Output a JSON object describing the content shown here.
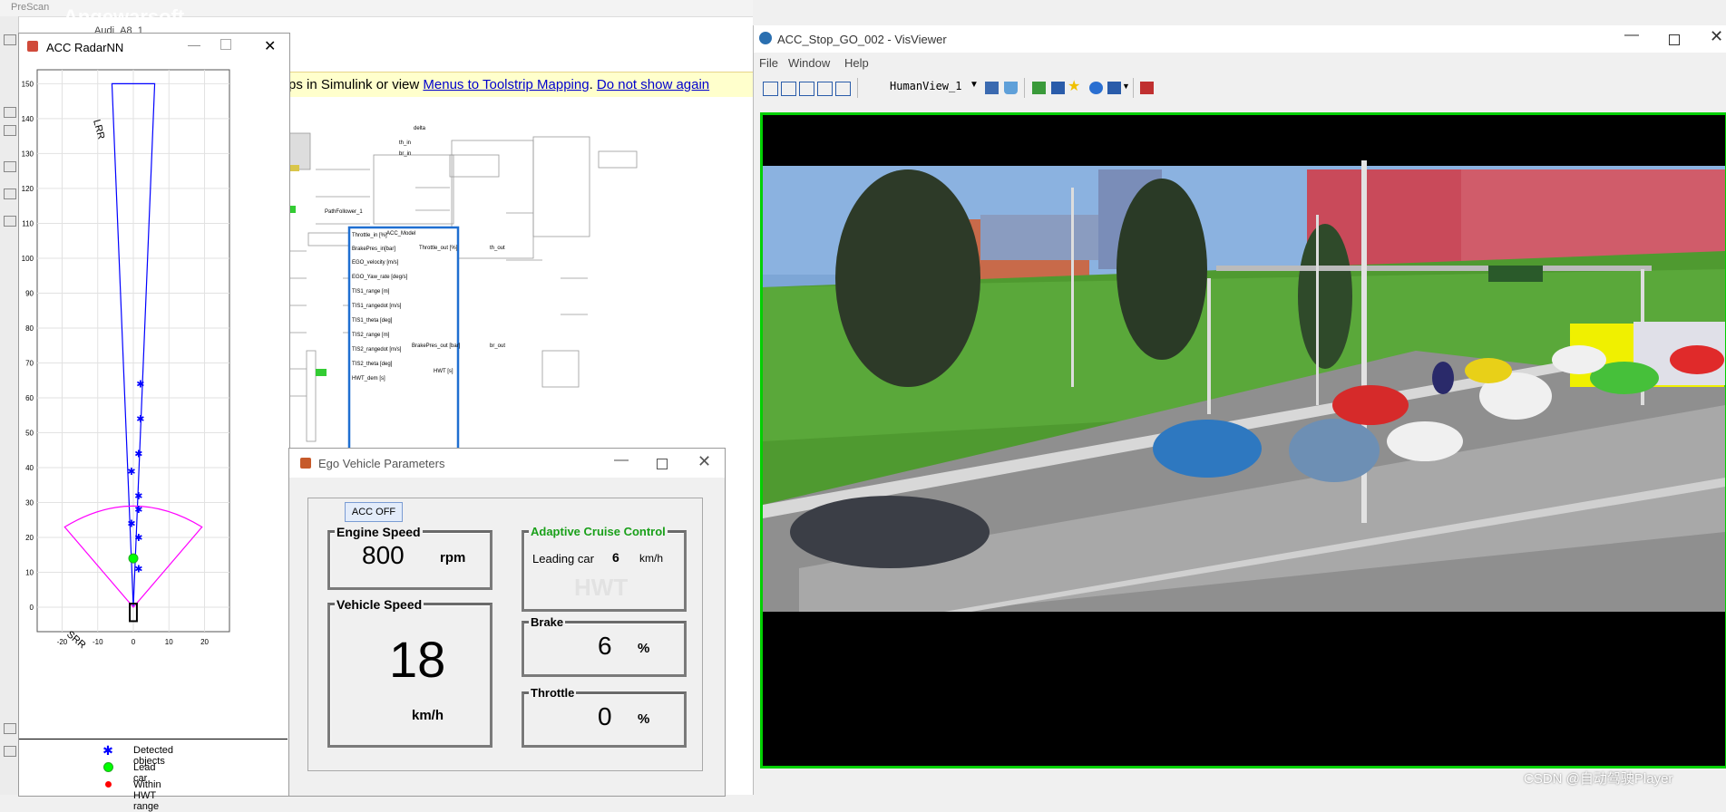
{
  "simulink": {
    "app_title": "PreScan",
    "watermark": "Angewarsoft",
    "model_tab": "Audi_A8_1",
    "notice": {
      "prefix": "ps in Simulink or view ",
      "link1": "Menus to Toolstrip Mapping",
      "sep": ". ",
      "link2": "Do not show again"
    },
    "blocks": {
      "acc_model": "ACC_Model",
      "throttle_in": "Throttle_in [%]",
      "brake_in": "BrakePres_in[bar]",
      "ego_velocity": "EGO_velocity [m/s]",
      "ego_yaw": "EGO_Yaw_rate [deg/s]",
      "tis1_range": "TIS1_range [m]",
      "tis1_rangedot": "TIS1_rangedot [m/s]",
      "tis1_theta": "TIS1_theta [deg]",
      "tis2_range": "TIS2_range [m]",
      "tis2_rangedot": "TIS2_rangedot [m/s]",
      "tis2_theta": "TIS2_theta [deg]",
      "hwt_dem": "HWT_dem [s]",
      "throttle_out": "Throttle_out [%]",
      "brake_out": "BrakePres_out [bar]",
      "hwt_s": "HWT [s]",
      "th_out": "th_out",
      "br_out": "br_out",
      "th_in": "th_in",
      "br_in": "br_in",
      "delta": "delta",
      "path_follower": "PathFollower_1"
    }
  },
  "radar": {
    "title": "ACC RadarNN",
    "lrr_label": "LRR",
    "srr_label": "SRR",
    "y_ticks": [
      "150",
      "140",
      "130",
      "120",
      "110",
      "100",
      "90",
      "80",
      "70",
      "60",
      "50",
      "40",
      "30",
      "20",
      "10",
      "0"
    ],
    "x_ticks": [
      "-20",
      "-10",
      "0",
      "10",
      "20"
    ],
    "detected": [
      [
        2,
        64
      ],
      [
        2,
        54
      ],
      [
        1.5,
        44
      ],
      [
        -0.5,
        39
      ],
      [
        1.5,
        32
      ],
      [
        1.5,
        28
      ],
      [
        -0.5,
        24
      ],
      [
        1.5,
        20
      ],
      [
        1.5,
        11
      ]
    ],
    "lead_car": [
      0,
      14
    ],
    "legend": {
      "detected": "Detected objects",
      "lead": "Lead car",
      "hwt": "Within HWT range"
    },
    "colors": {
      "lrr": "#0000ff",
      "srr": "#ff00ff",
      "detected": "#0000ff",
      "lead": "#00ff00",
      "hwt": "#ff0000"
    }
  },
  "ego": {
    "title": "Ego Vehicle Parameters",
    "acc_button": "ACC OFF",
    "engine_speed_label": "Engine Speed",
    "engine_speed_value": "800",
    "engine_speed_unit": "rpm",
    "vehicle_speed_label": "Vehicle Speed",
    "vehicle_speed_value": "18",
    "vehicle_speed_unit": "km/h",
    "acc_label": "Adaptive Cruise Control",
    "leading_car_label": "Leading car",
    "leading_car_value": "6",
    "leading_car_unit": "km/h",
    "hwt_label": "HWT",
    "brake_label": "Brake",
    "brake_value": "6",
    "brake_unit": "%",
    "throttle_label": "Throttle",
    "throttle_value": "0",
    "throttle_unit": "%"
  },
  "vis": {
    "title": "ACC_Stop_GO_002 - VisViewer",
    "menu": {
      "file": "File",
      "window": "Window",
      "help": "Help"
    },
    "view": "HumanView_1"
  },
  "watermark_csdn": "CSDN @自动驾驶Player"
}
